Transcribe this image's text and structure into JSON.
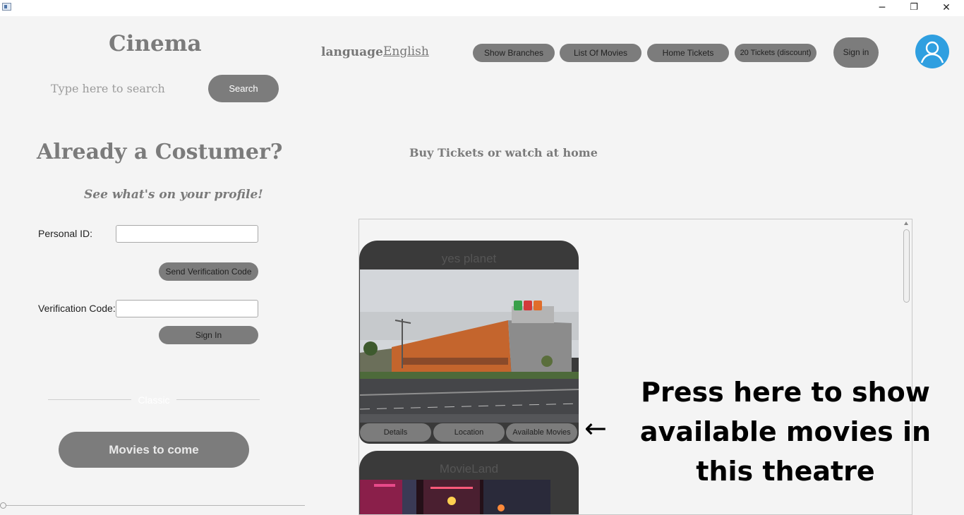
{
  "window": {
    "minimize_glyph": "─",
    "maximize_glyph": "❐",
    "close_glyph": "✕"
  },
  "header": {
    "brand": "Cinema",
    "language_label": "language",
    "language_value": "English",
    "nav": [
      "Show Branches",
      "List Of Movies",
      "Home Tickets",
      "20 Tickets (discount)"
    ],
    "sign_in": "Sign in",
    "avatar_icon": "user-icon",
    "accent_color": "#2f9fe0"
  },
  "search": {
    "placeholder": "Type here to search",
    "button": "Search"
  },
  "login": {
    "heading": "Already a Costumer?",
    "subheading": "See what's on your profile!",
    "personal_id_label": "Personal ID:",
    "send_code_button": "Send Verification Code",
    "verification_label": "Verification Code:",
    "sign_in_button": "Sign In"
  },
  "classic": {
    "label": "Classic",
    "movies_to_come": "Movies to come"
  },
  "main": {
    "heading": "Buy Tickets or watch at home",
    "branches": [
      {
        "name": "yes planet",
        "actions": [
          "Details",
          "Location",
          "Available Movies"
        ]
      },
      {
        "name": "MovieLand"
      }
    ]
  },
  "annotation": {
    "arrow": "←",
    "text": "Press here to show available movies in this theatre"
  }
}
